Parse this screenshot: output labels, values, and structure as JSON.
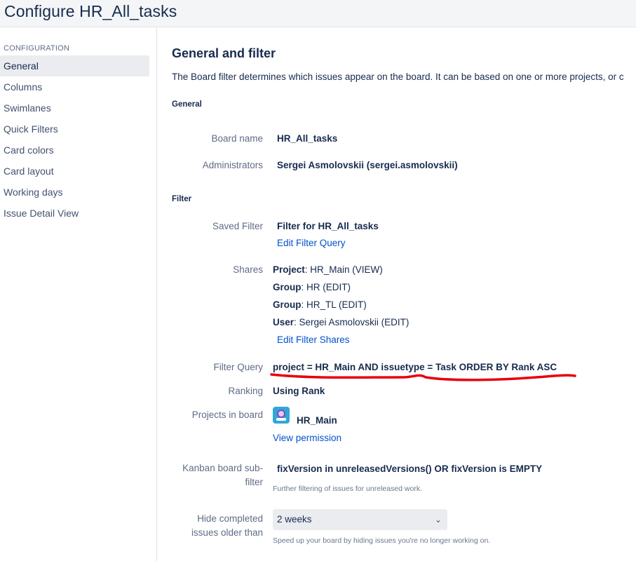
{
  "header": {
    "title": "Configure HR_All_tasks"
  },
  "sidebar": {
    "heading": "CONFIGURATION",
    "items": [
      {
        "label": "General",
        "active": true
      },
      {
        "label": "Columns"
      },
      {
        "label": "Swimlanes"
      },
      {
        "label": "Quick Filters"
      },
      {
        "label": "Card colors"
      },
      {
        "label": "Card layout"
      },
      {
        "label": "Working days"
      },
      {
        "label": "Issue Detail View"
      }
    ]
  },
  "main": {
    "title": "General and filter",
    "intro": "The Board filter determines which issues appear on the board. It can be based on one or more projects, or c",
    "general": {
      "heading": "General",
      "board_name_label": "Board name",
      "board_name": "HR_All_tasks",
      "administrators_label": "Administrators",
      "administrators": "Sergei Asmolovskii (sergei.asmolovskii)"
    },
    "filter": {
      "heading": "Filter",
      "saved_filter_label": "Saved Filter",
      "saved_filter": "Filter for HR_All_tasks",
      "edit_query_link": "Edit Filter Query",
      "shares_label": "Shares",
      "shares": [
        {
          "type": "Project",
          "value": ": HR_Main (VIEW)"
        },
        {
          "type": "Group",
          "value": ": HR (EDIT)"
        },
        {
          "type": "Group",
          "value": ": HR_TL (EDIT)"
        },
        {
          "type": "User",
          "value": ": Sergei Asmolovskii (EDIT)"
        }
      ],
      "edit_shares_link": "Edit Filter Shares",
      "filter_query_label": "Filter Query",
      "filter_query": "project = HR_Main AND issuetype = Task ORDER BY Rank ASC",
      "ranking_label": "Ranking",
      "ranking": "Using Rank",
      "projects_label": "Projects in board",
      "project_name": "HR_Main",
      "view_permission_link": "View permission",
      "subfilter_label_1": "Kanban board sub-",
      "subfilter_label_2": "filter",
      "subfilter": "fixVersion in unreleasedVersions() OR fixVersion is EMPTY",
      "subfilter_hint": "Further filtering of issues for unreleased work.",
      "hide_label_1": "Hide completed",
      "hide_label_2": "issues older than",
      "hide_value": "2 weeks",
      "hide_hint": "Speed up your board by hiding issues you're no longer working on."
    }
  },
  "colors": {
    "accent": "#0052cc",
    "annotation": "#e8000d"
  }
}
